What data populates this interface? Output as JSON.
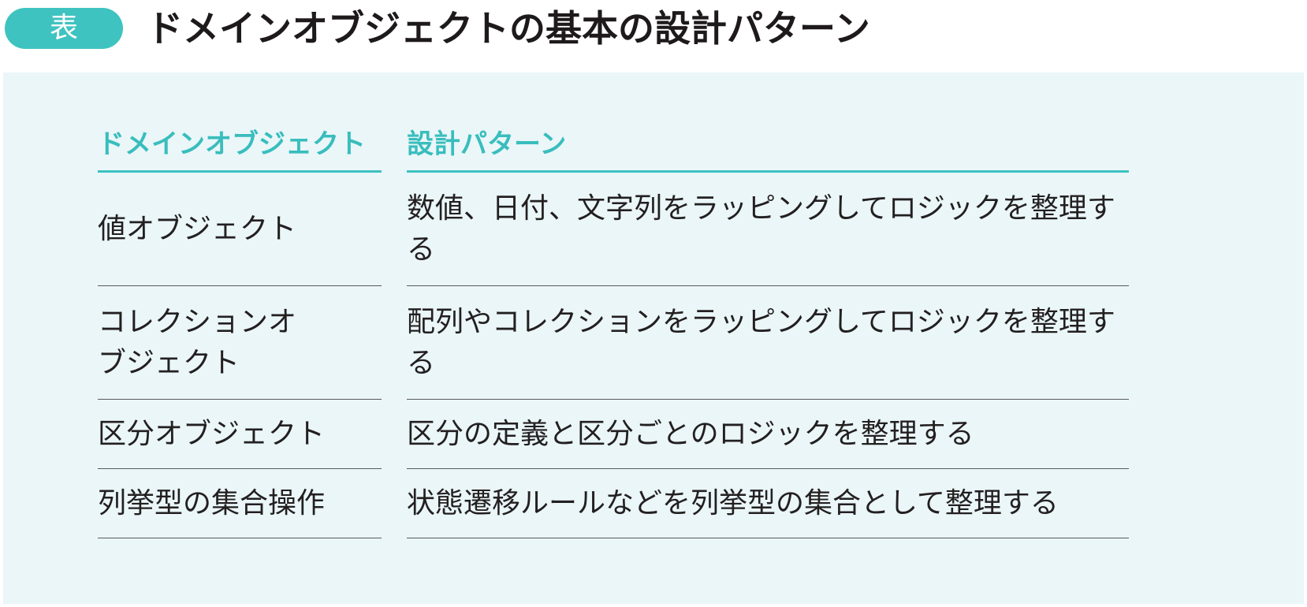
{
  "header": {
    "badge": "表",
    "title": "ドメインオブジェクトの基本の設計パターン"
  },
  "table": {
    "columns": {
      "object": "ドメインオブジェクト",
      "pattern": "設計パターン"
    },
    "rows": [
      {
        "object": "値オブジェクト",
        "pattern": "数値、日付、文字列をラッピングしてロジックを整理する"
      },
      {
        "object": "コレクションオブジェクト",
        "pattern": "配列やコレクションをラッピングしてロジックを整理する"
      },
      {
        "object": "区分オブジェクト",
        "pattern": "区分の定義と区分ごとのロジックを整理する"
      },
      {
        "object": "列挙型の集合操作",
        "pattern": "状態遷移ルールなどを列挙型の集合として整理する"
      }
    ]
  },
  "colors": {
    "accent": "#3fc3c1",
    "panel_background": "#eaf6f8",
    "text": "#231f20"
  }
}
